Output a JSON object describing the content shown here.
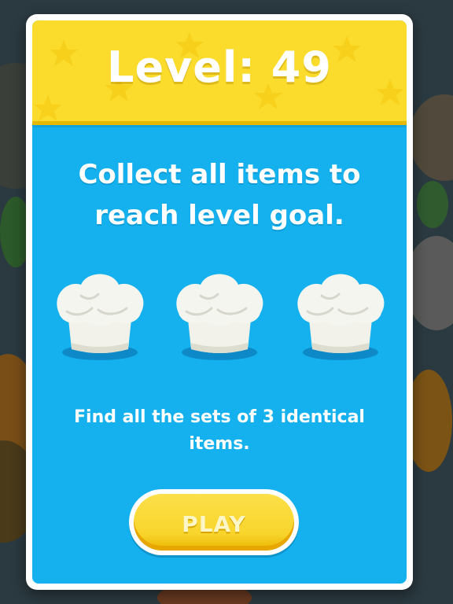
{
  "level_dialog": {
    "title": "Level: 49",
    "goal_text": "Collect all items to reach level goal.",
    "goal_items": [
      {
        "icon": "chef-hat-icon"
      },
      {
        "icon": "chef-hat-icon"
      },
      {
        "icon": "chef-hat-icon"
      }
    ],
    "hint_text": "Find all the sets of 3 identical items.",
    "play_label": "PLAY"
  },
  "colors": {
    "header_yellow": "#fbdc2c",
    "panel_blue": "#15b1ee",
    "button_yellow": "#f9d52c",
    "backdrop": "#2b3a41"
  }
}
